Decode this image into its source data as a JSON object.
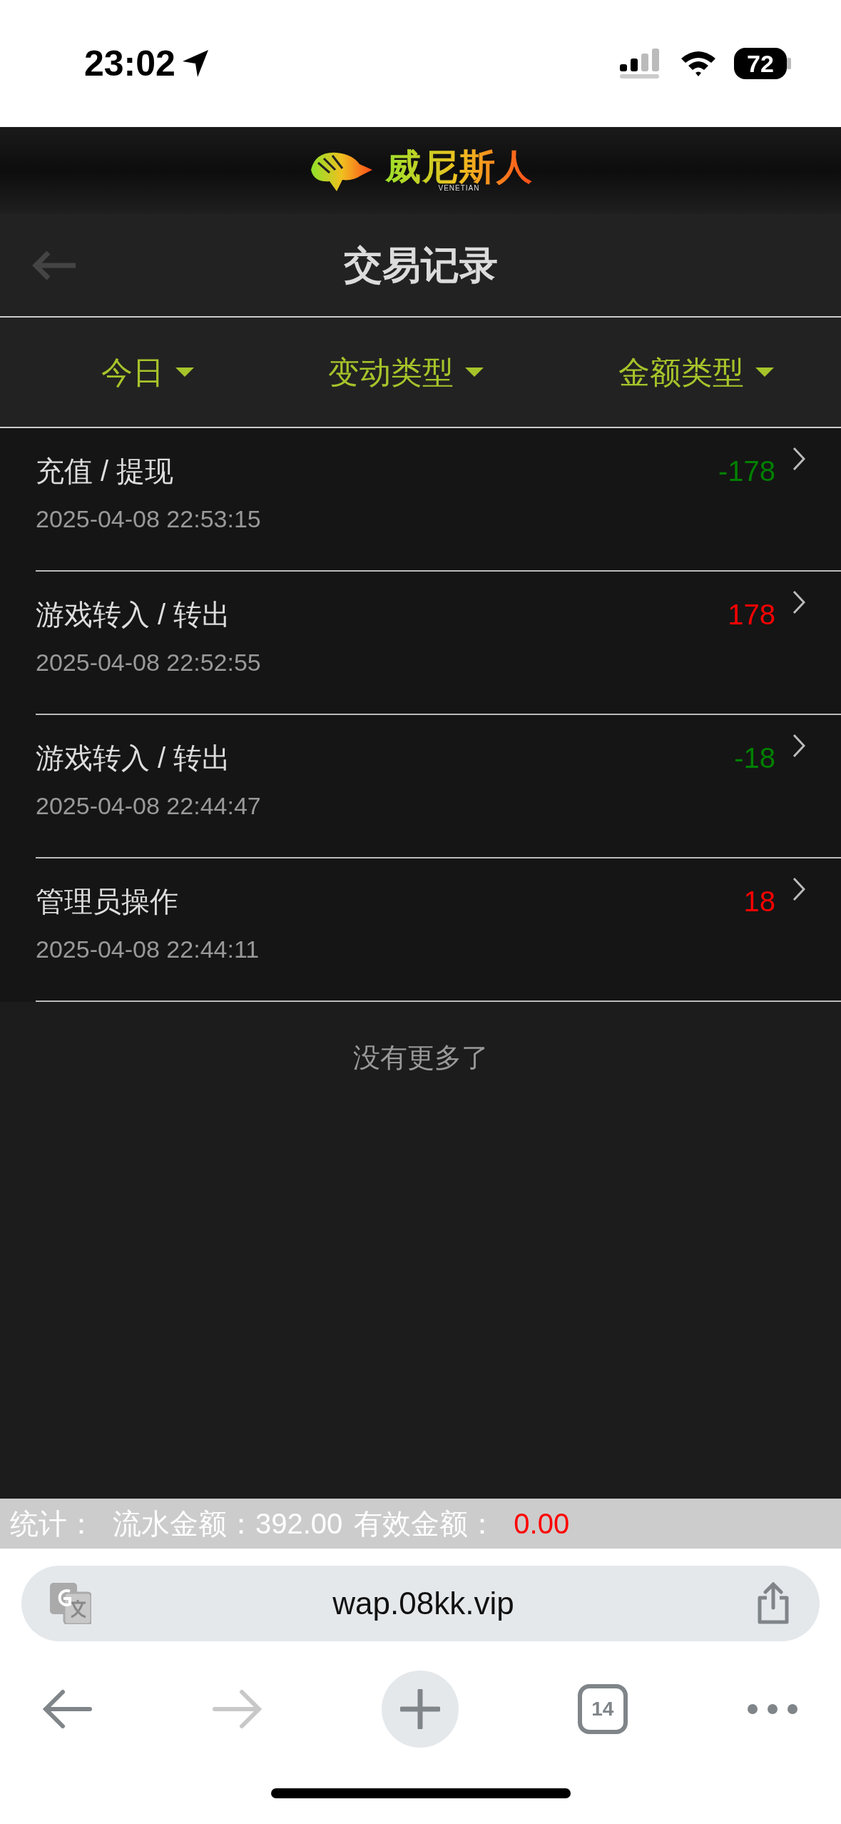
{
  "status_bar": {
    "time": "23:02",
    "battery": "72"
  },
  "banner": {
    "logo_text": "威尼斯人",
    "logo_subtext": "VENETIAN"
  },
  "header": {
    "title": "交易记录"
  },
  "filters": [
    {
      "label": "今日"
    },
    {
      "label": "变动类型"
    },
    {
      "label": "金额类型"
    }
  ],
  "records": [
    {
      "title": "充值 / 提现",
      "time": "2025-04-08 22:53:15",
      "amount": "-178",
      "color": "#008000"
    },
    {
      "title": "游戏转入 / 转出",
      "time": "2025-04-08 22:52:55",
      "amount": "178",
      "color": "#ff0000"
    },
    {
      "title": "游戏转入 / 转出",
      "time": "2025-04-08 22:44:47",
      "amount": "-18",
      "color": "#008000"
    },
    {
      "title": "管理员操作",
      "time": "2025-04-08 22:44:11",
      "amount": "18",
      "color": "#ff0000"
    }
  ],
  "end_message": "没有更多了",
  "summary": {
    "label": "统计：",
    "turnover": "流水金额：392.00",
    "valid_label": "有效金额：",
    "valid_amount": "0.00"
  },
  "browser": {
    "url": "wap.08kk.vip",
    "tab_count": "14"
  }
}
